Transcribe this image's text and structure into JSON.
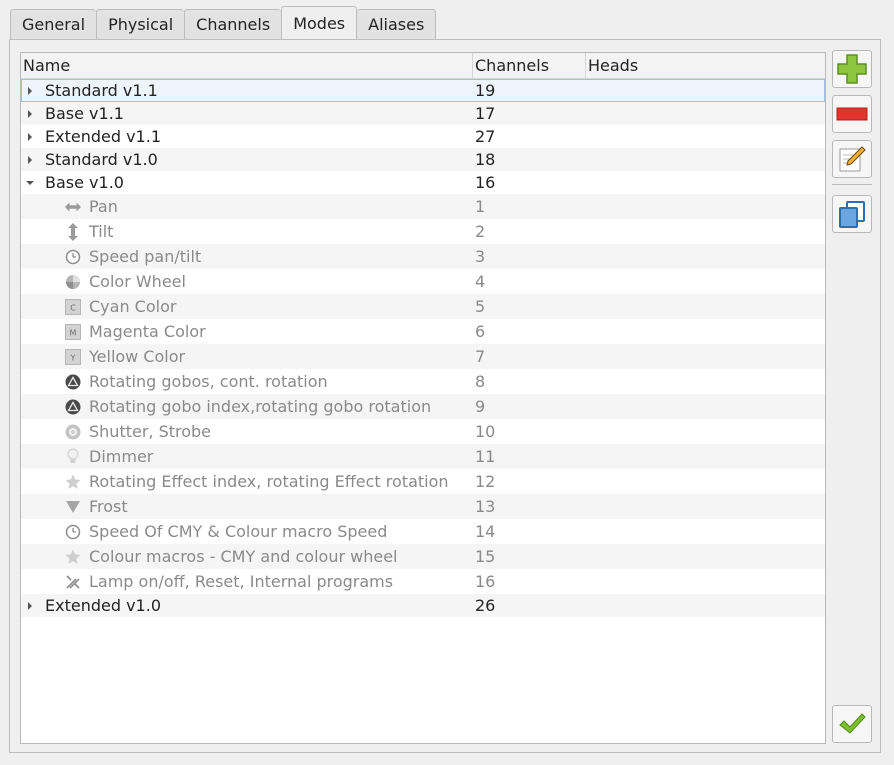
{
  "tabs": [
    {
      "label": "General"
    },
    {
      "label": "Physical"
    },
    {
      "label": "Channels"
    },
    {
      "label": "Modes"
    },
    {
      "label": "Aliases"
    }
  ],
  "columns": {
    "name": "Name",
    "channels": "Channels",
    "heads": "Heads"
  },
  "modes": [
    {
      "name": "Standard v1.1",
      "channels": "19",
      "expanded": false,
      "selected": true
    },
    {
      "name": "Base v1.1",
      "channels": "17",
      "expanded": false
    },
    {
      "name": "Extended v1.1",
      "channels": "27",
      "expanded": false
    },
    {
      "name": "Standard v1.0",
      "channels": "18",
      "expanded": false
    },
    {
      "name": "Base v1.0",
      "channels": "16",
      "expanded": true,
      "children": [
        {
          "name": "Pan",
          "number": "1",
          "icon": "pan-icon"
        },
        {
          "name": "Tilt",
          "number": "2",
          "icon": "tilt-icon"
        },
        {
          "name": "Speed pan/tilt",
          "number": "3",
          "icon": "speed-icon"
        },
        {
          "name": "Color Wheel",
          "number": "4",
          "icon": "color-wheel-icon"
        },
        {
          "name": "Cyan Color",
          "number": "5",
          "icon": "cyan-icon",
          "letter": "C"
        },
        {
          "name": "Magenta Color",
          "number": "6",
          "icon": "magenta-icon",
          "letter": "M"
        },
        {
          "name": "Yellow Color",
          "number": "7",
          "icon": "yellow-icon",
          "letter": "Y"
        },
        {
          "name": "Rotating gobos, cont. rotation",
          "number": "8",
          "icon": "gobo-icon"
        },
        {
          "name": "Rotating gobo index,rotating gobo rotation",
          "number": "9",
          "icon": "gobo-icon"
        },
        {
          "name": "Shutter, Strobe",
          "number": "10",
          "icon": "shutter-icon"
        },
        {
          "name": "Dimmer",
          "number": "11",
          "icon": "dimmer-icon"
        },
        {
          "name": "Rotating Effect index, rotating Effect rotation",
          "number": "12",
          "icon": "effect-star-icon"
        },
        {
          "name": "Frost",
          "number": "13",
          "icon": "frost-icon"
        },
        {
          "name": "Speed Of CMY & Colour macro Speed",
          "number": "14",
          "icon": "speed-icon"
        },
        {
          "name": "Colour macros - CMY and colour wheel",
          "number": "15",
          "icon": "effect-star-icon"
        },
        {
          "name": "Lamp on/off, Reset, Internal programs",
          "number": "16",
          "icon": "maintenance-icon"
        }
      ]
    },
    {
      "name": "Extended v1.0",
      "channels": "26",
      "expanded": false
    }
  ],
  "sidebar": [
    "add-mode",
    "remove-mode",
    "edit-mode",
    "clone-mode",
    "ok"
  ]
}
